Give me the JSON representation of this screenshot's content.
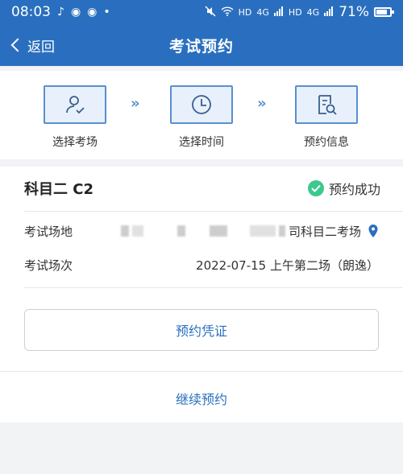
{
  "status_bar": {
    "time": "08:03",
    "left_icons": [
      "tiktok-icon",
      "weibo-icon",
      "weibo-icon",
      "dot-icon"
    ],
    "right_labels": [
      "HD",
      "4G",
      "HD",
      "4G"
    ],
    "battery_text": "71%",
    "battery_level": 0.71
  },
  "nav": {
    "back_label": "返回",
    "title": "考试预约"
  },
  "steps": [
    {
      "label": "选择考场",
      "icon": "user-check-icon"
    },
    {
      "label": "选择时间",
      "icon": "clock-icon"
    },
    {
      "label": "预约信息",
      "icon": "document-search-icon"
    }
  ],
  "step_arrow": "»",
  "booking": {
    "subject": "科目二 C2",
    "status": "预约成功",
    "venue_label": "考试场地",
    "venue_value_suffix": "司科目二考场",
    "session_label": "考试场次",
    "session_value": "2022-07-15 上午第二场（朗逸）"
  },
  "actions": {
    "voucher": "预约凭证",
    "continue": "继续预约"
  },
  "colors": {
    "primary": "#2a6fbf",
    "success": "#3cc88e",
    "step_border": "#5a8fd0",
    "step_bg": "#e8f0fb"
  }
}
